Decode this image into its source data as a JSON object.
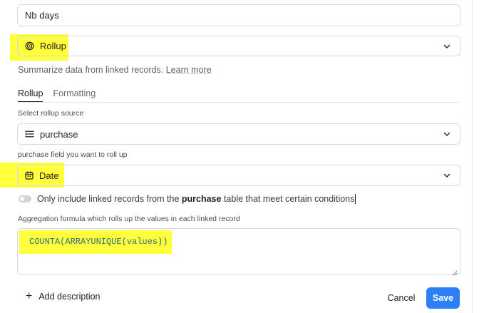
{
  "field_name": {
    "value": "Nb days"
  },
  "field_type": {
    "icon": "rollup-spiral-icon",
    "label": "Rollup"
  },
  "help": {
    "text": "Summarize data from linked records.",
    "link": "Learn more"
  },
  "tabs": [
    {
      "label": "Rollup",
      "active": true
    },
    {
      "label": "Formatting",
      "active": false
    }
  ],
  "rollup_source": {
    "label": "Select rollup source",
    "icon": "linked-record-list-icon",
    "value": "purchase"
  },
  "rollup_field": {
    "label": "purchase field you want to roll up",
    "icon": "calendar-icon",
    "value": "Date"
  },
  "condition_toggle": {
    "prefix": "Only include linked records from the ",
    "table": "purchase",
    "suffix": " table that meet certain conditions",
    "enabled": false
  },
  "aggregation": {
    "label": "Aggregation formula which rolls up the values in each linked record",
    "formula": "COUNTA(ARRAYUNIQUE(values))"
  },
  "footer": {
    "add_description": "Add description",
    "cancel": "Cancel",
    "save": "Save"
  },
  "colors": {
    "primary": "#2d7ff9",
    "highlight": "#ffff1a",
    "formula_text": "#2e6f80"
  }
}
